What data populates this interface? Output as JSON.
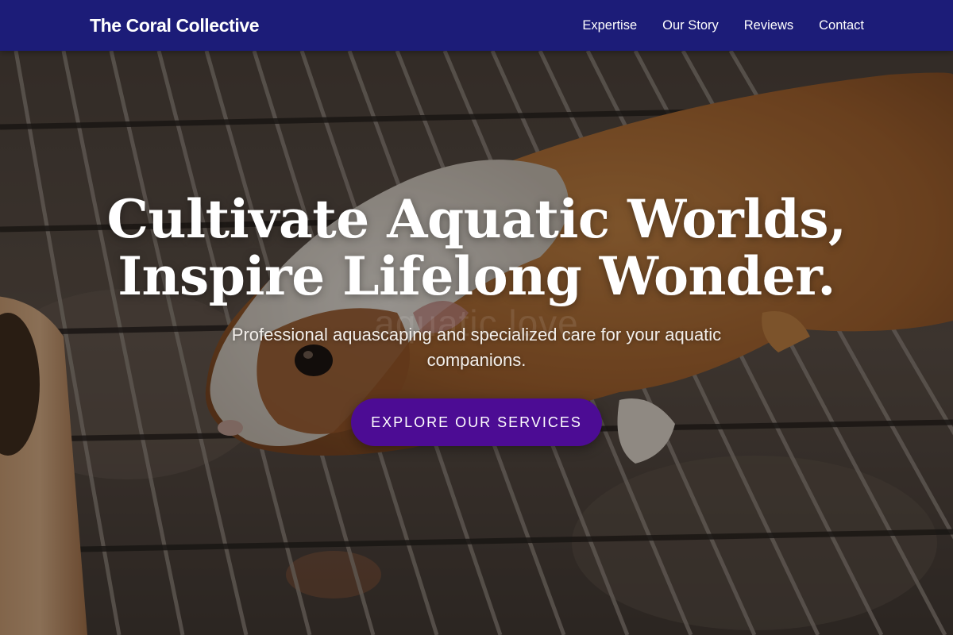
{
  "nav": {
    "brand": "The Coral Collective",
    "links": [
      {
        "label": "Expertise"
      },
      {
        "label": "Our Story"
      },
      {
        "label": "Reviews"
      },
      {
        "label": "Contact"
      }
    ]
  },
  "hero": {
    "headline_line1": "Cultivate Aquatic Worlds,",
    "headline_line2": "Inspire Lifelong Wonder.",
    "subtext": "Professional aquascaping and specialized care for your aquatic companions.",
    "watermark": "aquatic love",
    "cta_label": "Explore Our Services",
    "image_subject": "guinea pig on metal cage grate"
  },
  "colors": {
    "nav_background": "#1c1c78",
    "cta_background": "#4c0c94",
    "text": "#ffffff"
  }
}
